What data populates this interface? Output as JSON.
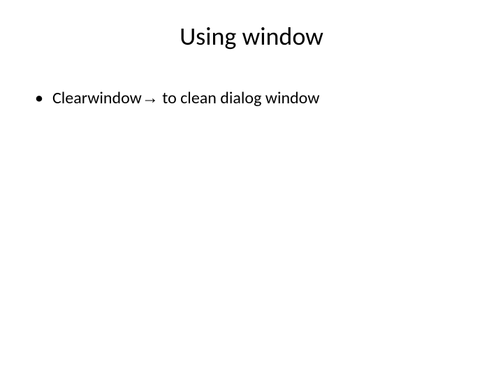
{
  "slide": {
    "title": "Using window",
    "bullets": [
      {
        "text_before": "Clearwindow",
        "arrow": "→",
        "text_after": " to clean dialog window"
      }
    ]
  }
}
